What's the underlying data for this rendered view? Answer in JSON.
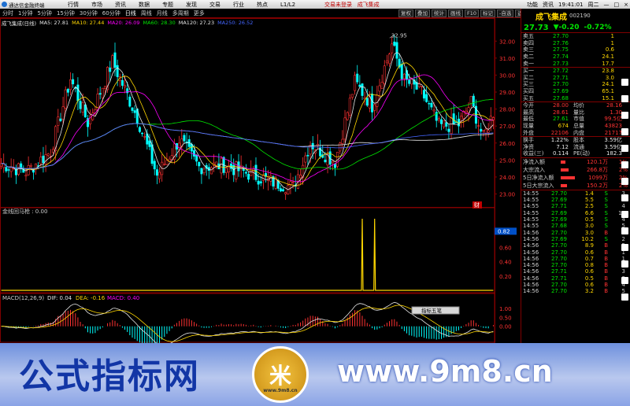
{
  "app": {
    "title": "通达信金融终端",
    "menu": [
      "行情",
      "市场",
      "资讯",
      "数据",
      "专题",
      "发现",
      "交易",
      "行业",
      "热点",
      "L1/L2"
    ],
    "center_title": "交易未登录",
    "stock_tab": "成飞集成",
    "right_items": [
      "功能",
      "资讯",
      "19:41:01",
      "周二"
    ]
  },
  "toolbar": {
    "periods": [
      "分时",
      "1分钟",
      "5分钟",
      "15分钟",
      "30分钟",
      "60分钟",
      "日线",
      "周线",
      "月线",
      "多周期",
      "更多"
    ],
    "active_period": "日线",
    "buttons": [
      "复权",
      "叠加",
      "统计",
      "画线",
      "F10",
      "标记",
      "-自选",
      "返回"
    ]
  },
  "ma_bar": [
    {
      "label": "成飞集成(日线)",
      "color": "#e6e6e6"
    },
    {
      "label": "MA5: 27.81",
      "color": "#e6e6e6"
    },
    {
      "label": "MA10: 27.44",
      "color": "#ffd700"
    },
    {
      "label": "MA20: 26.09",
      "color": "#ff00ff"
    },
    {
      "label": "MA60: 28.30",
      "color": "#00e600"
    },
    {
      "label": "MA120: 27.23",
      "color": "#e6e6e6"
    },
    {
      "label": "MA250: 26.52",
      "color": "#4466ff"
    }
  ],
  "chart_data": [
    {
      "type": "candlestick",
      "title": "成飞集成(日线)",
      "price_axis": [
        "32.00",
        "31.00",
        "30.00",
        "29.00",
        "28.00",
        "27.00",
        "26.00",
        "25.00",
        "24.00",
        "23.00"
      ],
      "ylim": [
        22.7,
        32.8
      ],
      "high_label": "32.95",
      "n_bars": 200,
      "series": [
        {
          "name": "MA5",
          "color": "#e6e6e6"
        },
        {
          "name": "MA10",
          "color": "#ffd700"
        },
        {
          "name": "MA20",
          "color": "#ff00ff"
        },
        {
          "name": "MA60",
          "color": "#00e600"
        },
        {
          "name": "MA120",
          "color": "#e6e6e6"
        },
        {
          "name": "MA250",
          "color": "#4466ff"
        }
      ]
    },
    {
      "type": "line",
      "title": "金线回马枪 : 0.00",
      "axis": [
        "0.82",
        "0.60",
        "0.40",
        "0.20"
      ],
      "ylim": [
        0,
        1
      ],
      "current_label": "0.82",
      "spikes_x": [
        146,
        151
      ],
      "spike_y": 1.0
    },
    {
      "type": "bar",
      "title": "MACD(12,26,9)",
      "dif": "DIF: 0.04",
      "dea": "DEA: -0.16",
      "macd": "MACD: 0.40",
      "axis": [
        "1.00",
        "0.50",
        "0.00"
      ],
      "ylim": [
        -0.8,
        1.3
      ]
    }
  ],
  "chart_widgets": {
    "tag": "财",
    "popup": "指标五笔"
  },
  "quote": {
    "name": "成飞集成",
    "code": "002190",
    "price": "27.73",
    "change": "▼-0.20",
    "pct": "-0.72%",
    "asks": [
      {
        "l": "卖五",
        "p": "27.70",
        "v": "1"
      },
      {
        "l": "卖四",
        "p": "27.76",
        "v": "1"
      },
      {
        "l": "卖三",
        "p": "27.75",
        "v": "0.6"
      },
      {
        "l": "卖二",
        "p": "27.74",
        "v": "24.1"
      },
      {
        "l": "卖一",
        "p": "27.73",
        "v": "17.7"
      }
    ],
    "bids": [
      {
        "l": "买一",
        "p": "27.72",
        "v": "23.8"
      },
      {
        "l": "买二",
        "p": "27.71",
        "v": "3.0"
      },
      {
        "l": "买三",
        "p": "27.70",
        "v": "24.1"
      },
      {
        "l": "买四",
        "p": "27.69",
        "v": "65.1"
      },
      {
        "l": "买五",
        "p": "27.68",
        "v": "15.1"
      }
    ],
    "stats": [
      {
        "l1": "今开",
        "v1": "28.00",
        "c1": "red",
        "l2": "均价",
        "v2": "28.16"
      },
      {
        "l1": "最高",
        "v1": "28.61",
        "c1": "red",
        "l2": "量比",
        "v2": "1.30"
      },
      {
        "l1": "最低",
        "v1": "27.61",
        "c1": "grn",
        "l2": "市值",
        "v2": "99.5亿"
      },
      {
        "l1": "现量",
        "v1": "674",
        "c1": "yel",
        "l2": "总量",
        "v2": "43823"
      },
      {
        "l1": "外盘",
        "v1": "22106",
        "c1": "red",
        "l2": "内盘",
        "v2": "21717"
      }
    ],
    "stats2": [
      {
        "l1": "换手",
        "v1": "1.22%",
        "l2": "股本",
        "v2": "3.59亿"
      },
      {
        "l1": "净资",
        "v1": "7.12",
        "l2": "流通",
        "v2": "3.59亿"
      },
      {
        "l1": "收益(三)",
        "v1": "0.114",
        "l2": "PE(动)",
        "v2": "182.3"
      }
    ],
    "flows": [
      {
        "l": "净流入额",
        "v": "120.1万",
        "p": "1%",
        "w": 0.3
      },
      {
        "l": "大宗流入",
        "v": "266.8万",
        "p": "2%",
        "w": 0.5
      },
      {
        "l": "5日净流入额",
        "v": "1099万",
        "p": "2%",
        "w": 0.9
      },
      {
        "l": "5日大宗流入",
        "v": "150.2万",
        "p": "2%",
        "w": 0.4
      }
    ],
    "ticks": [
      {
        "t": "14:55",
        "p": "27.70",
        "v": "1.4",
        "bs": "S",
        "n": "3"
      },
      {
        "t": "14:55",
        "p": "27.69",
        "v": "5.5",
        "bs": "S",
        "n": "4"
      },
      {
        "t": "14:55",
        "p": "27.71",
        "v": "2.5",
        "bs": "S",
        "n": "4"
      },
      {
        "t": "14:55",
        "p": "27.69",
        "v": "6.6",
        "bs": "S",
        "n": "11"
      },
      {
        "t": "14:55",
        "p": "27.69",
        "v": "0.5",
        "bs": "S",
        "n": "4"
      },
      {
        "t": "14:55",
        "p": "27.68",
        "v": "3.0",
        "bs": "S",
        "n": "5"
      },
      {
        "t": "14:56",
        "p": "27.70",
        "v": "3.0",
        "bs": "B",
        "n": "6"
      },
      {
        "t": "14:56",
        "p": "27.69",
        "v": "10.2",
        "bs": "S",
        "n": "2"
      },
      {
        "t": "14:56",
        "p": "27.70",
        "v": "8.9",
        "bs": "B",
        "n": "5"
      },
      {
        "t": "14:56",
        "p": "27.70",
        "v": "0.6",
        "bs": "B",
        "n": "1"
      },
      {
        "t": "14:56",
        "p": "27.70",
        "v": "0.7",
        "bs": "B",
        "n": "1"
      },
      {
        "t": "14:56",
        "p": "27.70",
        "v": "0.8",
        "bs": "B",
        "n": "3"
      },
      {
        "t": "14:56",
        "p": "27.71",
        "v": "0.6",
        "bs": "B",
        "n": "3"
      },
      {
        "t": "14:56",
        "p": "27.71",
        "v": "0.5",
        "bs": "B",
        "n": "3"
      },
      {
        "t": "14:56",
        "p": "27.70",
        "v": "0.6",
        "bs": "B",
        "n": "4"
      },
      {
        "t": "14:56",
        "p": "27.70",
        "v": "3.2",
        "bs": "B",
        "n": "5"
      }
    ]
  },
  "banner": {
    "left_text": "公式指标网",
    "right_text": "www.9m8.cn",
    "badge_text": "米",
    "badge_sub": "www.9m8.cn"
  },
  "colors": {
    "up": "#ff3232",
    "down": "#00ffff",
    "frame": "#800000"
  }
}
